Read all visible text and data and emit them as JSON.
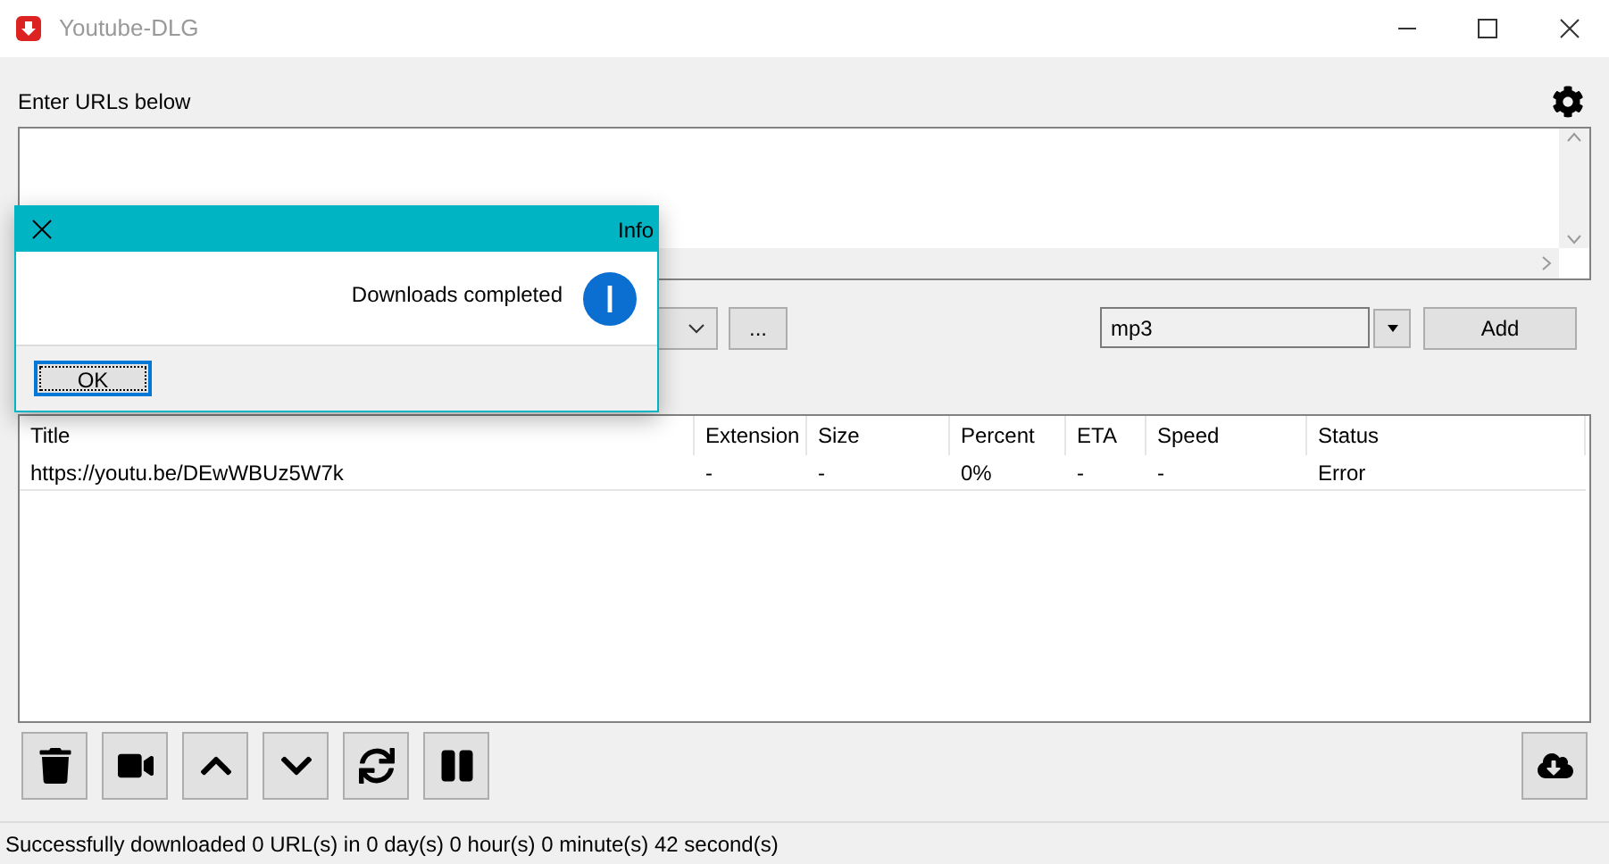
{
  "window": {
    "title": "Youtube-DLG"
  },
  "url_label": "Enter URLs below",
  "path_button": "...",
  "format_field": {
    "value": "mp3"
  },
  "add_button": "Add",
  "table": {
    "columns": [
      "Title",
      "Extension",
      "Size",
      "Percent",
      "ETA",
      "Speed",
      "Status"
    ],
    "rows": [
      [
        "https://youtu.be/DEwWBUz5W7k",
        "-",
        "-",
        "0%",
        "-",
        "-",
        "Error"
      ]
    ]
  },
  "status_bar": "Successfully downloaded 0 URL(s) in 0 day(s) 0 hour(s) 0 minute(s) 42 second(s)",
  "dialog": {
    "title": "Info",
    "message": "Downloads completed",
    "button": "OK"
  }
}
